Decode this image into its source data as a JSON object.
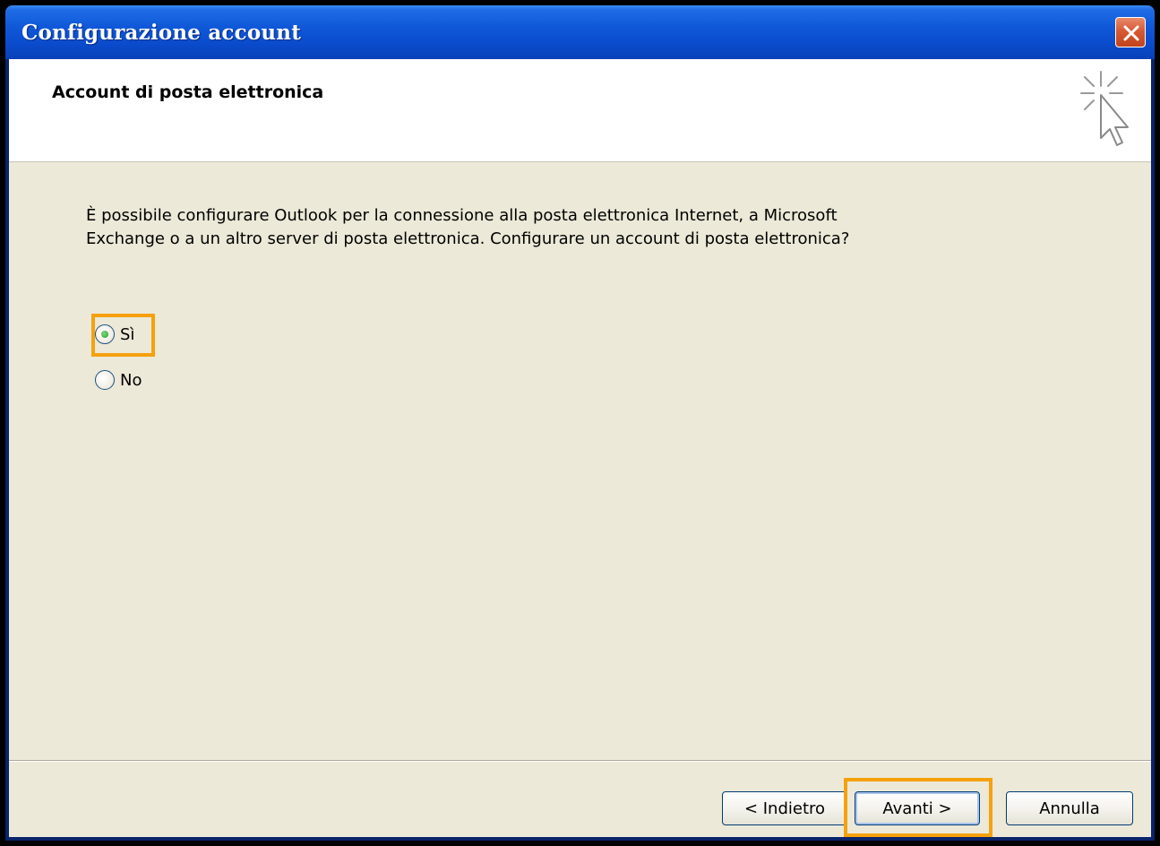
{
  "window": {
    "title": "Configurazione account"
  },
  "header": {
    "title": "Account di posta elettronica",
    "icon": "cursor-sparkle-icon"
  },
  "content": {
    "description": "È possibile configurare Outlook per la connessione alla posta elettronica Internet, a Microsoft Exchange o a un altro server di posta elettronica. Configurare un account di posta elettronica?",
    "options": [
      {
        "label": "Sì",
        "selected": true
      },
      {
        "label": "No",
        "selected": false
      }
    ]
  },
  "footer": {
    "back_label": "< Indietro",
    "next_label": "Avanti >",
    "cancel_label": "Annulla"
  },
  "colors": {
    "highlight": "#f5a10e",
    "titlebar": "#0a4ccd",
    "close_button": "#d65a35",
    "dialog_background": "#ece9d8"
  }
}
